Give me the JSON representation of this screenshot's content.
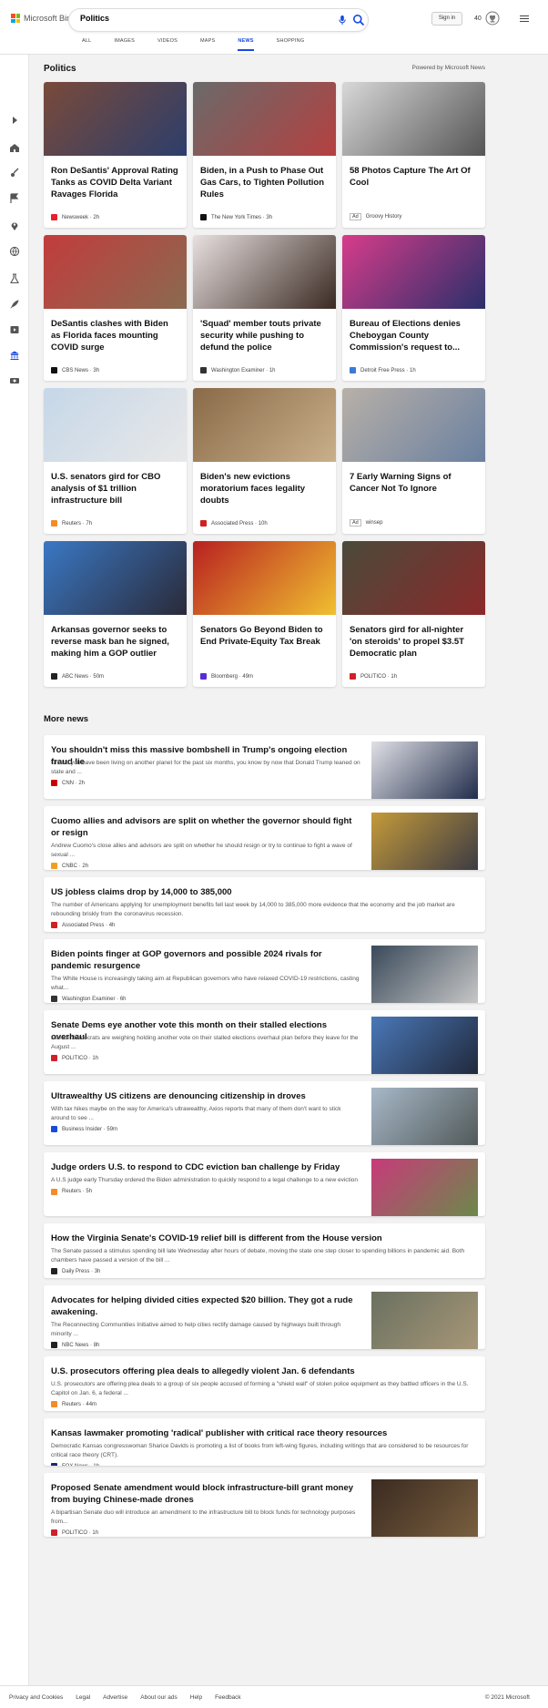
{
  "header": {
    "brand": "Microsoft Bing",
    "search_value": "Politics",
    "signin_label": "Sign in",
    "points": "40",
    "tabs": [
      {
        "label": "ALL",
        "active": false
      },
      {
        "label": "IMAGES",
        "active": false
      },
      {
        "label": "VIDEOS",
        "active": false
      },
      {
        "label": "MAPS",
        "active": false
      },
      {
        "label": "NEWS",
        "active": true
      },
      {
        "label": "SHOPPING",
        "active": false
      }
    ]
  },
  "sidebar": {
    "icons": [
      "expand-icon",
      "home-icon",
      "sports-icon",
      "flag-icon",
      "location-icon",
      "globe-icon",
      "science-icon",
      "rocket-icon",
      "entertainment-icon",
      "politics-icon",
      "money-icon"
    ]
  },
  "section": {
    "title": "Politics",
    "powered_by": "Powered by Microsoft News"
  },
  "cards": [
    {
      "title": "Ron DeSantis' Approval Rating Tanks as COVID Delta Variant Ravages Florida",
      "source": "Newsweek",
      "time": "2h",
      "ad": false,
      "src_color": "#e8202a",
      "img_a": "#7a4a3a",
      "img_b": "#2c3e6b"
    },
    {
      "title": "Biden, in a Push to Phase Out Gas Cars, to Tighten Pollution Rules",
      "source": "The New York Times",
      "time": "3h",
      "ad": false,
      "src_color": "#111111",
      "img_a": "#6a6a6a",
      "img_b": "#b54040"
    },
    {
      "title": "58 Photos Capture The Art Of Cool",
      "source": "Groovy History",
      "time": "",
      "ad": true,
      "ad_label": "Ad",
      "src_color": "#ffffff",
      "img_a": "#d8d8d8",
      "img_b": "#555555"
    },
    {
      "title": "DeSantis clashes with Biden as Florida faces mounting COVID surge",
      "source": "CBS News",
      "time": "3h",
      "ad": false,
      "src_color": "#111111",
      "img_a": "#c23c3c",
      "img_b": "#8a6a50"
    },
    {
      "title": "'Squad' member touts private security while pushing to defund the police",
      "source": "Washington Examiner",
      "time": "1h",
      "ad": false,
      "src_color": "#333333",
      "img_a": "#e8e0e0",
      "img_b": "#3a2a22"
    },
    {
      "title": "Bureau of Elections denies Cheboygan County Commission's request to...",
      "source": "Detroit Free Press",
      "time": "1h",
      "ad": false,
      "src_color": "#3a7bd5",
      "img_a": "#d73c8a",
      "img_b": "#2a2f6a"
    },
    {
      "title": "U.S. senators gird for CBO analysis of $1 trillion infrastructure bill",
      "source": "Reuters",
      "time": "7h",
      "ad": false,
      "src_color": "#f28c28",
      "img_a": "#c6d7e8",
      "img_b": "#e8e8e8"
    },
    {
      "title": "Biden's new evictions moratorium faces legality doubts",
      "source": "Associated Press",
      "time": "10h",
      "ad": false,
      "src_color": "#d02020",
      "img_a": "#8a6a48",
      "img_b": "#c9b08a"
    },
    {
      "title": "7 Early Warning Signs of Cancer Not To Ignore",
      "source": "winsep",
      "time": "",
      "ad": true,
      "ad_label": "Ad",
      "src_color": "#ffffff",
      "img_a": "#b8b0a8",
      "img_b": "#6a80a0"
    },
    {
      "title": "Arkansas governor seeks to reverse mask ban he signed, making him a GOP outlier",
      "source": "ABC News",
      "time": "50m",
      "ad": false,
      "src_color": "#222222",
      "img_a": "#3a78c4",
      "img_b": "#2a2a38"
    },
    {
      "title": "Senators Go Beyond Biden to End Private-Equity Tax Break",
      "source": "Bloomberg",
      "time": "49m",
      "ad": false,
      "src_color": "#5a2bd8",
      "img_a": "#b82020",
      "img_b": "#f0c030"
    },
    {
      "title": "Senators gird for all-nighter 'on steroids' to propel $3.5T Democratic plan",
      "source": "POLITICO",
      "time": "1h",
      "ad": false,
      "src_color": "#d0202a",
      "img_a": "#4a4a3a",
      "img_b": "#8a2a2a"
    }
  ],
  "more_news": {
    "title": "More news",
    "items": [
      {
        "title": "You shouldn't miss this massive bombshell in Trump's ongoing election fraud lie",
        "snippet": "Unless you have been living on another planet for the past six months, you know by now that Donald Trump leaned on state and ...",
        "source": "CNN",
        "time": "2h",
        "thumb": true,
        "src_color": "#cc0000",
        "img_a": "#e0e0e6",
        "img_b": "#1e2a48"
      },
      {
        "title": "Cuomo allies and advisors are split on whether the governor should fight or resign",
        "snippet": "Andrew Cuomo's close allies and advisors are split on whether he should resign or try to continue to fight a wave of sexual ...",
        "source": "CNBC",
        "time": "2h",
        "thumb": true,
        "src_color": "#f0a020",
        "img_a": "#c49a3a",
        "img_b": "#3a3a44"
      },
      {
        "title": "US jobless claims drop by 14,000 to 385,000",
        "snippet": "The number of Americans applying for unemployment benefits fell last week by 14,000 to 385,000 more evidence that the economy and the job market are rebounding briskly from the coronavirus recession.",
        "source": "Associated Press",
        "time": "4h",
        "thumb": false,
        "src_color": "#d02020"
      },
      {
        "title": "Biden points finger at GOP governors and possible 2024 rivals for pandemic resurgence",
        "snippet": "The White House is increasingly taking aim at Republican governors who have relaxed COVID-19 restrictions, casting what...",
        "source": "Washington Examiner",
        "time": "6h",
        "thumb": true,
        "src_color": "#333333",
        "img_a": "#3a4a5a",
        "img_b": "#c8c8c8"
      },
      {
        "title": "Senate Dems eye another vote this month on their stalled elections overhaul",
        "snippet": "Senate Democrats are weighing holding another vote on their stalled elections overhaul plan before they leave for the August ...",
        "source": "POLITICO",
        "time": "1h",
        "thumb": true,
        "src_color": "#d0202a",
        "img_a": "#4a78b8",
        "img_b": "#20283a"
      },
      {
        "title": "Ultrawealthy US citizens are denouncing citizenship in droves",
        "snippet": "With tax hikes maybe on the way for America's ultrawealthy, Axios reports that many of them don't want to stick around to see ...",
        "source": "Business Insider",
        "time": "59m",
        "thumb": true,
        "src_color": "#1a4ad8",
        "img_a": "#a8b8c8",
        "img_b": "#505858"
      },
      {
        "title": "Judge orders U.S. to respond to CDC eviction ban challenge by Friday",
        "snippet": "A U.S judge early Thursday ordered the Biden administration to quickly respond to a legal challenge to a new eviction ...",
        "source": "Reuters",
        "time": "5h",
        "thumb": true,
        "src_color": "#f28c28",
        "img_a": "#c83a7a",
        "img_b": "#6a8a4a"
      },
      {
        "title": "How the Virginia Senate's COVID-19 relief bill is different from the House version",
        "snippet": "The Senate passed a stimulus spending bill late Wednesday after hours of debate, moving the state one step closer to spending billions in pandemic aid. Both chambers have passed a version of the bill ...",
        "source": "Daily Press",
        "time": "3h",
        "thumb": false,
        "src_color": "#222222"
      },
      {
        "title": "Advocates for helping divided cities expected $20 billion. They got a rude awakening.",
        "snippet": "The Reconnecting Communities Initiative aimed to help cities rectify damage caused by highways built through minority ...",
        "source": "NBC News",
        "time": "8h",
        "thumb": true,
        "src_color": "#222222",
        "img_a": "#6a7060",
        "img_b": "#a89878"
      },
      {
        "title": "U.S. prosecutors offering plea deals to allegedly violent Jan. 6 defendants",
        "snippet": "U.S. prosecutors are offering plea deals to a group of six people accused of forming a \"shield wall\" of stolen police equipment as they battled officers in the U.S. Capitol on Jan. 6, a federal ...",
        "source": "Reuters",
        "time": "44m",
        "thumb": false,
        "src_color": "#f28c28"
      },
      {
        "title": "Kansas lawmaker promoting 'radical' publisher with critical race theory resources",
        "snippet": "Democratic Kansas congresswoman Sharice Davids is promoting a list of books from left-wing figures, including writings that are considered to be resources for critical race theory (CRT).",
        "source": "FOX News",
        "time": "1h",
        "thumb": false,
        "src_color": "#1a2a6a"
      },
      {
        "title": "Proposed Senate amendment would block infrastructure-bill grant money from buying Chinese-made drones",
        "snippet": "A bipartisan Senate duo will introduce an amendment to the infrastructure bill to block funds for technology purposes from...",
        "source": "POLITICO",
        "time": "1h",
        "thumb": true,
        "src_color": "#d0202a",
        "img_a": "#3a2a20",
        "img_b": "#7a6040"
      }
    ]
  },
  "footer": {
    "links": [
      "Privacy and Cookies",
      "Legal",
      "Advertise",
      "About our ads",
      "Help",
      "Feedback"
    ],
    "copyright": "© 2021 Microsoft"
  }
}
